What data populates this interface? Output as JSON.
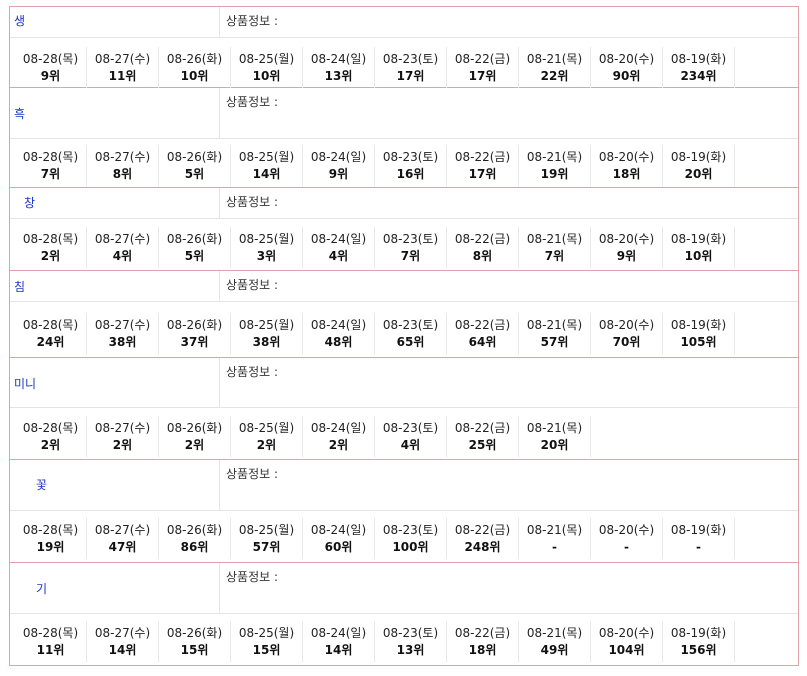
{
  "info_label": "상품정보 :",
  "products": [
    {
      "name": "생",
      "days": [
        {
          "date": "08-28(목)",
          "rank": "9위"
        },
        {
          "date": "08-27(수)",
          "rank": "11위"
        },
        {
          "date": "08-26(화)",
          "rank": "10위"
        },
        {
          "date": "08-25(월)",
          "rank": "10위"
        },
        {
          "date": "08-24(일)",
          "rank": "13위"
        },
        {
          "date": "08-23(토)",
          "rank": "17위"
        },
        {
          "date": "08-22(금)",
          "rank": "17위"
        },
        {
          "date": "08-21(목)",
          "rank": "22위"
        },
        {
          "date": "08-20(수)",
          "rank": "90위"
        },
        {
          "date": "08-19(화)",
          "rank": "234위"
        }
      ]
    },
    {
      "name": "흑",
      "days": [
        {
          "date": "08-28(목)",
          "rank": "7위"
        },
        {
          "date": "08-27(수)",
          "rank": "8위"
        },
        {
          "date": "08-26(화)",
          "rank": "5위"
        },
        {
          "date": "08-25(월)",
          "rank": "14위"
        },
        {
          "date": "08-24(일)",
          "rank": "9위"
        },
        {
          "date": "08-23(토)",
          "rank": "16위"
        },
        {
          "date": "08-22(금)",
          "rank": "17위"
        },
        {
          "date": "08-21(목)",
          "rank": "19위"
        },
        {
          "date": "08-20(수)",
          "rank": "18위"
        },
        {
          "date": "08-19(화)",
          "rank": "20위"
        }
      ]
    },
    {
      "name": "창",
      "days": [
        {
          "date": "08-28(목)",
          "rank": "2위"
        },
        {
          "date": "08-27(수)",
          "rank": "4위"
        },
        {
          "date": "08-26(화)",
          "rank": "5위"
        },
        {
          "date": "08-25(월)",
          "rank": "3위"
        },
        {
          "date": "08-24(일)",
          "rank": "4위"
        },
        {
          "date": "08-23(토)",
          "rank": "7위"
        },
        {
          "date": "08-22(금)",
          "rank": "8위"
        },
        {
          "date": "08-21(목)",
          "rank": "7위"
        },
        {
          "date": "08-20(수)",
          "rank": "9위"
        },
        {
          "date": "08-19(화)",
          "rank": "10위"
        }
      ]
    },
    {
      "name": "침",
      "days": [
        {
          "date": "08-28(목)",
          "rank": "24위"
        },
        {
          "date": "08-27(수)",
          "rank": "38위"
        },
        {
          "date": "08-26(화)",
          "rank": "37위"
        },
        {
          "date": "08-25(월)",
          "rank": "38위"
        },
        {
          "date": "08-24(일)",
          "rank": "48위"
        },
        {
          "date": "08-23(토)",
          "rank": "65위"
        },
        {
          "date": "08-22(금)",
          "rank": "64위"
        },
        {
          "date": "08-21(목)",
          "rank": "57위"
        },
        {
          "date": "08-20(수)",
          "rank": "70위"
        },
        {
          "date": "08-19(화)",
          "rank": "105위"
        }
      ]
    },
    {
      "name": "미니",
      "days": [
        {
          "date": "08-28(목)",
          "rank": "2위"
        },
        {
          "date": "08-27(수)",
          "rank": "2위"
        },
        {
          "date": "08-26(화)",
          "rank": "2위"
        },
        {
          "date": "08-25(월)",
          "rank": "2위"
        },
        {
          "date": "08-24(일)",
          "rank": "2위"
        },
        {
          "date": "08-23(토)",
          "rank": "4위"
        },
        {
          "date": "08-22(금)",
          "rank": "25위"
        },
        {
          "date": "08-21(목)",
          "rank": "20위"
        }
      ]
    },
    {
      "name": "꽃",
      "days": [
        {
          "date": "08-28(목)",
          "rank": "19위"
        },
        {
          "date": "08-27(수)",
          "rank": "47위"
        },
        {
          "date": "08-26(화)",
          "rank": "86위"
        },
        {
          "date": "08-25(월)",
          "rank": "57위"
        },
        {
          "date": "08-24(일)",
          "rank": "60위"
        },
        {
          "date": "08-23(토)",
          "rank": "100위"
        },
        {
          "date": "08-22(금)",
          "rank": "248위"
        },
        {
          "date": "08-21(목)",
          "rank": "-"
        },
        {
          "date": "08-20(수)",
          "rank": "-"
        },
        {
          "date": "08-19(화)",
          "rank": "-"
        }
      ]
    },
    {
      "name": "기",
      "days": [
        {
          "date": "08-28(목)",
          "rank": "11위"
        },
        {
          "date": "08-27(수)",
          "rank": "14위"
        },
        {
          "date": "08-26(화)",
          "rank": "15위"
        },
        {
          "date": "08-25(월)",
          "rank": "15위"
        },
        {
          "date": "08-24(일)",
          "rank": "14위"
        },
        {
          "date": "08-23(토)",
          "rank": "13위"
        },
        {
          "date": "08-22(금)",
          "rank": "18위"
        },
        {
          "date": "08-21(목)",
          "rank": "49위"
        },
        {
          "date": "08-20(수)",
          "rank": "104위"
        },
        {
          "date": "08-19(화)",
          "rank": "156위"
        }
      ]
    }
  ]
}
